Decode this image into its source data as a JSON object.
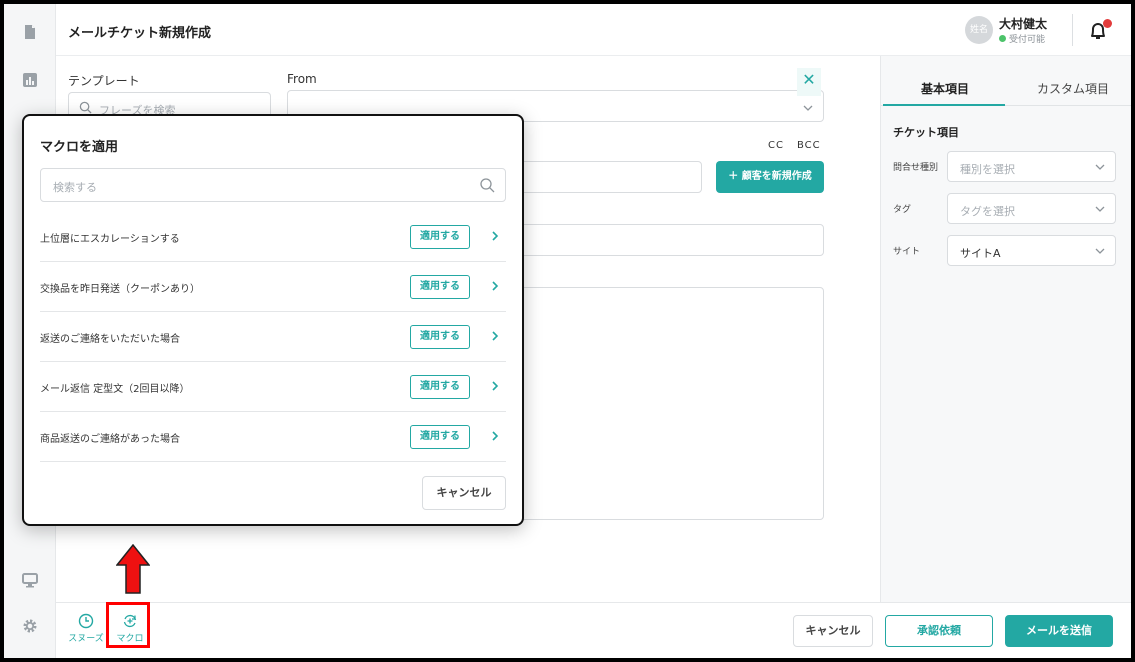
{
  "header": {
    "title": "メールチケット新規作成",
    "user_avatar_text": "姓名",
    "user_name": "大村健太",
    "user_status": "受付可能"
  },
  "form": {
    "template_label": "テンプレート",
    "template_placeholder": "フレーズを検索",
    "from_label": "From",
    "cc_label": "CC",
    "bcc_label": "BCC",
    "new_customer_button": "＋ 顧客を新規作成"
  },
  "right_panel": {
    "tab_basic": "基本項目",
    "tab_custom": "カスタム項目",
    "section_title": "チケット項目",
    "fields": [
      {
        "label": "問合せ種別",
        "value": "種別を選択",
        "is_placeholder": true
      },
      {
        "label": "タグ",
        "value": "タグを選択",
        "is_placeholder": true
      },
      {
        "label": "サイト",
        "value": "サイトA",
        "is_placeholder": false
      }
    ]
  },
  "footer": {
    "snooze_label": "スヌーズ",
    "macro_label": "マクロ",
    "cancel_label": "キャンセル",
    "approval_label": "承認依頼",
    "send_label": "メールを送信"
  },
  "macro_modal": {
    "title": "マクロを適用",
    "search_placeholder": "検索する",
    "apply_label": "適用する",
    "cancel_label": "キャンセル",
    "items": [
      {
        "name": "上位層にエスカレーションする"
      },
      {
        "name": "交換品を昨日発送（クーポンあり）"
      },
      {
        "name": "返送のご連絡をいただいた場合"
      },
      {
        "name": "メール返信 定型文（2回目以降）"
      },
      {
        "name": "商品返送のご連絡があった場合"
      }
    ]
  },
  "colors": {
    "accent": "#23a8a3",
    "annotation": "#ff0000",
    "status_online": "#4cc36a",
    "notification": "#e23b3b"
  }
}
